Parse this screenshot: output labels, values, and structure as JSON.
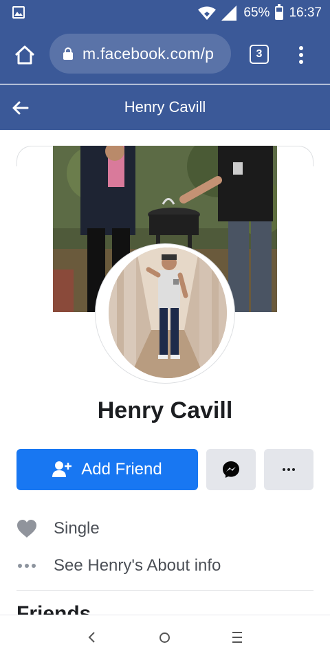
{
  "status_bar": {
    "battery": "65%",
    "battery_level": 0.65,
    "time": "16:37",
    "icons": [
      "gallery-icon",
      "wifi-icon",
      "signal-icon",
      "battery-icon"
    ]
  },
  "browser": {
    "url": "m.facebook.com/p",
    "tab_count": "3",
    "icons": [
      "home-icon",
      "lock-icon",
      "tabs-icon",
      "overflow-menu-icon"
    ]
  },
  "header": {
    "title": "Henry Cavill",
    "back_icon": "arrow-left-icon"
  },
  "profile": {
    "name": "Henry Cavill"
  },
  "actions": {
    "add_friend_label": "Add Friend",
    "add_friend_icon": "person-add-icon",
    "messenger_icon": "messenger-icon",
    "more_icon": "more-dots-icon"
  },
  "info": {
    "items": [
      {
        "icon": "heart-icon",
        "label": "Single"
      },
      {
        "icon": "more-dots-icon",
        "label": "See Henry's About info"
      }
    ]
  },
  "next_section": {
    "title": "Friends"
  },
  "colors": {
    "fb_blue": "#3b5998",
    "button_blue": "#1877f2",
    "button_gray": "#e4e6eb"
  },
  "nav": {
    "icons": [
      "back-icon",
      "home-circle-icon",
      "recents-icon"
    ]
  }
}
